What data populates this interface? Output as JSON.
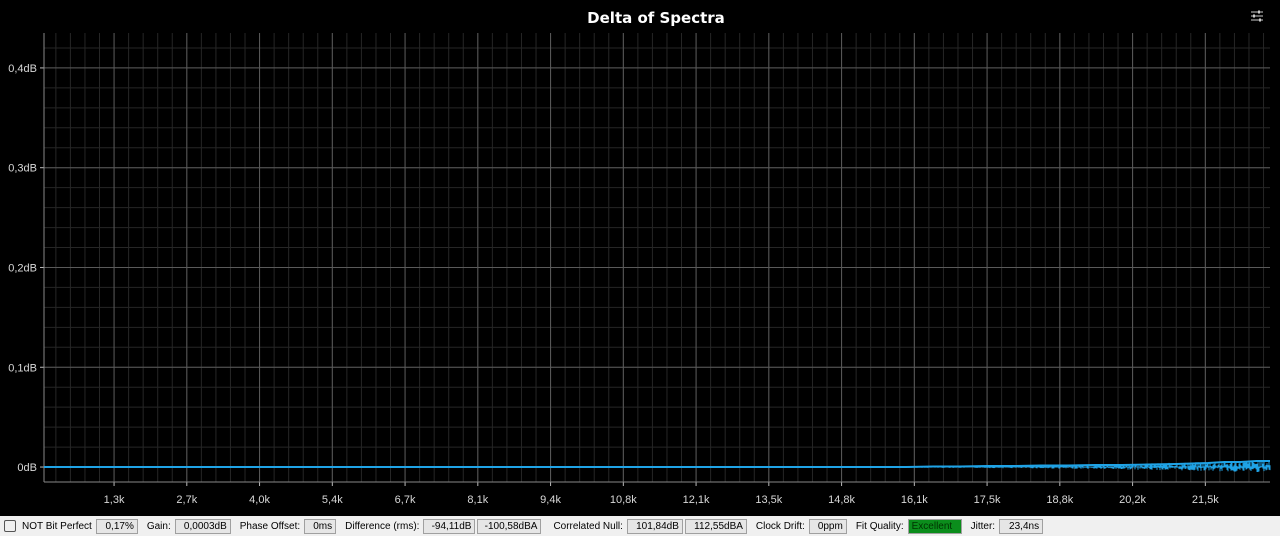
{
  "chart_data": {
    "type": "line",
    "title": "Delta of Spectra",
    "xlabel": "",
    "ylabel": "",
    "x_ticks": [
      "1,3k",
      "2,7k",
      "4,0k",
      "5,4k",
      "6,7k",
      "8,1k",
      "9,4k",
      "10,8k",
      "12,1k",
      "13,5k",
      "14,8k",
      "16,1k",
      "17,5k",
      "18,8k",
      "20,2k",
      "21,5k"
    ],
    "x_tick_values": [
      1300,
      2650,
      4000,
      5350,
      6700,
      8050,
      9400,
      10750,
      12100,
      13450,
      14800,
      16150,
      17500,
      18850,
      20200,
      21550
    ],
    "xlim": [
      0,
      22750
    ],
    "y_ticks": [
      "0dB",
      "0,1dB",
      "0,2dB",
      "0,3dB",
      "0,4dB"
    ],
    "y_tick_values": [
      0,
      0.1,
      0.2,
      0.3,
      0.4
    ],
    "ylim": [
      -0.015,
      0.435
    ],
    "grid": true,
    "series": [
      {
        "color": "#1fa3e6",
        "x": [
          0,
          2000,
          4000,
          6000,
          8000,
          10000,
          12000,
          14000,
          15000,
          16000,
          16500,
          17000,
          17500,
          18000,
          18500,
          19000,
          19500,
          20000,
          20500,
          21000,
          21300,
          21600,
          21900,
          22200,
          22500,
          22750
        ],
        "y": [
          0.0,
          0.0,
          0.0,
          0.0,
          0.0,
          0.0,
          0.0,
          0.0,
          0.0,
          0.0,
          0.0005,
          0.0005,
          0.001,
          0.001,
          0.0015,
          0.0015,
          0.002,
          0.002,
          0.0025,
          0.003,
          0.0035,
          0.004,
          0.005,
          0.005,
          0.006,
          0.006
        ]
      }
    ]
  },
  "status_bar": {
    "bit_perfect": "NOT Bit Perfect",
    "bit_perfect_value": "0,17%",
    "gain_label": "Gain:",
    "gain_value": "0,0003dB",
    "phase_label": "Phase Offset:",
    "phase_value": "0ms",
    "difference_label": "Difference (rms):",
    "difference_value": "-94,11dB",
    "difference_value_a": "-100,58dBA",
    "null_label": "Correlated Null:",
    "null_value": "101,84dB",
    "null_value_a": "112,55dBA",
    "drift_label": "Clock Drift:",
    "drift_value": "0ppm",
    "fit_label": "Fit Quality:",
    "fit_value": "Excellent",
    "jitter_label": "Jitter:",
    "jitter_value": "23,4ns"
  },
  "icons": {
    "settings": "sliders-icon",
    "status": "document-icon"
  },
  "colors": {
    "background": "#000000",
    "grid_major": "#5a5a5a",
    "grid_minor": "#262626",
    "trace": "#1fa3e6",
    "fit_good": "#0b8d1c"
  }
}
